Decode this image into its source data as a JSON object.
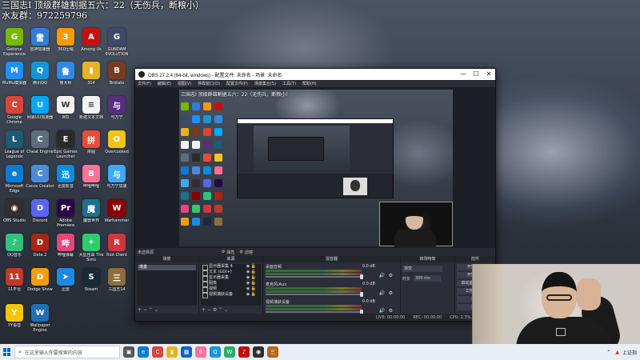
{
  "overlay": {
    "line1": "三国志Ⅰ 顶级群雄割据五六：22（无伤兵，断粮小）",
    "line2": "水友群：972259796"
  },
  "desktop_icons": [
    {
      "label": "Geforce Experience",
      "icon": "geforce-icon",
      "color": "#76b900",
      "glyph": "G"
    },
    {
      "label": "雷神加速器",
      "icon": "leishen-icon",
      "color": "#2f7ed8",
      "glyph": "雷"
    },
    {
      "label": "360压缩",
      "icon": "zip-360-icon",
      "color": "#f59a00",
      "glyph": "3"
    },
    {
      "label": "Among Us",
      "icon": "among-us-icon",
      "color": "#c51111",
      "glyph": "A"
    },
    {
      "label": "GUNDAM EVOLUTION",
      "icon": "gundam-icon",
      "color": "#3d4a6b",
      "glyph": "G"
    },
    {
      "label": "MuMu模拟器",
      "icon": "mumu-icon",
      "color": "#1e90ff",
      "glyph": "M"
    },
    {
      "label": "腾讯QQ",
      "icon": "qq-icon",
      "color": "#1296db",
      "glyph": "Q"
    },
    {
      "label": "鲁大师",
      "icon": "ludashi-icon",
      "color": "#2b8be6",
      "glyph": "鲁"
    },
    {
      "label": "314",
      "icon": "folder-icon",
      "color": "#e6b422",
      "glyph": "▮"
    },
    {
      "label": "Brotato",
      "icon": "brotato-icon",
      "color": "#7a3b1f",
      "glyph": "B"
    },
    {
      "label": "Google Chrome",
      "icon": "chrome-icon",
      "color": "#db4437",
      "glyph": "C"
    },
    {
      "label": "网易UU加速器",
      "icon": "uu-icon",
      "color": "#00a8ff",
      "glyph": "U"
    },
    {
      "label": "WD",
      "icon": "document-icon",
      "color": "#f3f3f3",
      "glyph": "W"
    },
    {
      "label": "新建文本文档",
      "icon": "text-file-icon",
      "color": "#f3f3f3",
      "glyph": "≡"
    },
    {
      "label": "与万宁",
      "icon": "game-icon",
      "color": "#5a2d82",
      "glyph": "与"
    },
    {
      "label": "League of Legends",
      "icon": "lol-icon",
      "color": "#1c5b73",
      "glyph": "L"
    },
    {
      "label": "Cheat Engine",
      "icon": "cheat-engine-icon",
      "color": "#5d6d7e",
      "glyph": "C"
    },
    {
      "label": "Epic Games Launcher",
      "icon": "epic-icon",
      "color": "#2a2a2a",
      "glyph": "E"
    },
    {
      "label": "拼图",
      "icon": "puzzle-icon",
      "color": "#e74c3c",
      "glyph": "拼"
    },
    {
      "label": "Overcooked",
      "icon": "overcooked-icon",
      "color": "#f0c419",
      "glyph": "O"
    },
    {
      "label": "Microsoft Edge",
      "icon": "edge-icon",
      "color": "#0c7bd6",
      "glyph": "e"
    },
    {
      "label": "Cocos Creator",
      "icon": "cocos-icon",
      "color": "#4e8bd6",
      "glyph": "C"
    },
    {
      "label": "迅雷影音",
      "icon": "xunlei-icon",
      "color": "#0a8de0",
      "glyph": "迅"
    },
    {
      "label": "哔哩哔哩",
      "icon": "bilibili-icon",
      "color": "#fb7299",
      "glyph": "B"
    },
    {
      "label": "与万宁加速",
      "icon": "accelerator-icon",
      "color": "#3fa9f5",
      "glyph": "与"
    },
    {
      "label": "OBS Studio",
      "icon": "obs-icon",
      "color": "#302e31",
      "glyph": "◉"
    },
    {
      "label": "Discord",
      "icon": "discord-icon",
      "color": "#5865f2",
      "glyph": "D"
    },
    {
      "label": "Adobe Premiere",
      "icon": "premiere-icon",
      "color": "#2a0845",
      "glyph": "Pr"
    },
    {
      "label": "魔兽世界",
      "icon": "wow-icon",
      "color": "#1f6f8b",
      "glyph": "魔"
    },
    {
      "label": "Warhammer",
      "icon": "warhammer-icon",
      "color": "#8b0000",
      "glyph": "W"
    },
    {
      "label": "QQ音乐",
      "icon": "qq-music-icon",
      "color": "#31c27c",
      "glyph": "♪"
    },
    {
      "label": "Dota 2",
      "icon": "dota-icon",
      "color": "#a72714",
      "glyph": "D"
    },
    {
      "label": "哔哩弹幕",
      "icon": "danmaku-icon",
      "color": "#e7457c",
      "glyph": "哔"
    },
    {
      "label": "大型自由 The Sims",
      "icon": "sims-icon",
      "color": "#2ecc71",
      "glyph": "✦"
    },
    {
      "label": "Riot Client",
      "icon": "riot-icon",
      "color": "#d13639",
      "glyph": "R"
    },
    {
      "label": "11平台",
      "icon": "platform-11-icon",
      "color": "#c0392b",
      "glyph": "11"
    },
    {
      "label": "Dodge Show",
      "icon": "dodge-icon",
      "color": "#f39c12",
      "glyph": "D"
    },
    {
      "label": "迅雷",
      "icon": "thunder-icon",
      "color": "#1e88e5",
      "glyph": "➤"
    },
    {
      "label": "Steam",
      "icon": "steam-icon",
      "color": "#1b2838",
      "glyph": "S"
    },
    {
      "label": "三国志14",
      "icon": "sanguo-icon",
      "color": "#8e6e3d",
      "glyph": "三"
    },
    {
      "label": "YY语音",
      "icon": "yy-icon",
      "color": "#f6c500",
      "glyph": "Y"
    },
    {
      "label": "Wallpaper Engine",
      "icon": "wallpaper-engine-icon",
      "color": "#1e6fb8",
      "glyph": "W"
    }
  ],
  "obs": {
    "title": "OBS 27.2.4 (64-bit, windows) - 配置文件: 未命名 - 场景: 未命名",
    "menu": [
      "文件(F)",
      "编辑(E)",
      "视图(V)",
      "停靠窗口(D)",
      "配置文件(P)",
      "场景集合(S)",
      "工具(T)",
      "帮助(H)"
    ],
    "preview_title": "三国志Ⅰ 顶级群雄割据五六：22（无伤兵，断粮小）",
    "status_left": "未选择源",
    "props_label": "属性",
    "filters_label": "滤镜",
    "docks": {
      "scenes": {
        "header": "场景",
        "items": [
          "场景"
        ]
      },
      "sources": {
        "header": "来源",
        "items": [
          "显示器采集 4",
          "文本 (GDI+)",
          "显示器采集",
          "图像",
          "视频",
          "视频捕获设备"
        ]
      },
      "mixer": {
        "header": "混音器",
        "channels": [
          {
            "name": "桌面音频",
            "value": "0.0 dB"
          },
          {
            "name": "麦克风/Aux",
            "value": "0.0 dB"
          },
          {
            "name": "视频捕获设备",
            "value": "0.0 dB"
          }
        ]
      },
      "transitions": {
        "header": "转场特效",
        "type_label": "渐变",
        "duration_label": "时长",
        "duration_value": "300 ms"
      },
      "controls": {
        "header": "控件",
        "buttons": [
          "开始直播",
          "开始录制",
          "启动虚拟摄像机",
          "工作室模式",
          "设置",
          "退出"
        ]
      }
    },
    "bottom": {
      "live": "LIVE: 00:00:00",
      "rec": "REC: 00:00:00",
      "cpu": "CPU: 2.3%, 60.00 fps"
    }
  },
  "taskbar": {
    "search_placeholder": "在这里输入你要搜索的内容",
    "apps": [
      {
        "icon": "task-view-icon",
        "color": "#555",
        "glyph": "▣"
      },
      {
        "icon": "edge-icon",
        "color": "#0c7bd6",
        "glyph": "e"
      },
      {
        "icon": "chrome-icon",
        "color": "#db4437",
        "glyph": "C"
      },
      {
        "icon": "file-explorer-icon",
        "color": "#e6b422",
        "glyph": "▮"
      },
      {
        "icon": "store-icon",
        "color": "#0a64c8",
        "glyph": "▦"
      },
      {
        "icon": "bilibili-icon",
        "color": "#fb7299",
        "glyph": "B"
      },
      {
        "icon": "qq-icon",
        "color": "#1296db",
        "glyph": "Q"
      },
      {
        "icon": "wechat-icon",
        "color": "#2aae67",
        "glyph": "W"
      },
      {
        "icon": "netease-music-icon",
        "color": "#c20c0c",
        "glyph": "♪"
      },
      {
        "icon": "obs-icon",
        "color": "#302e31",
        "glyph": "◉"
      },
      {
        "icon": "game-icon",
        "color": "#b5651d",
        "glyph": "三"
      }
    ],
    "tray_text": "上证指"
  }
}
